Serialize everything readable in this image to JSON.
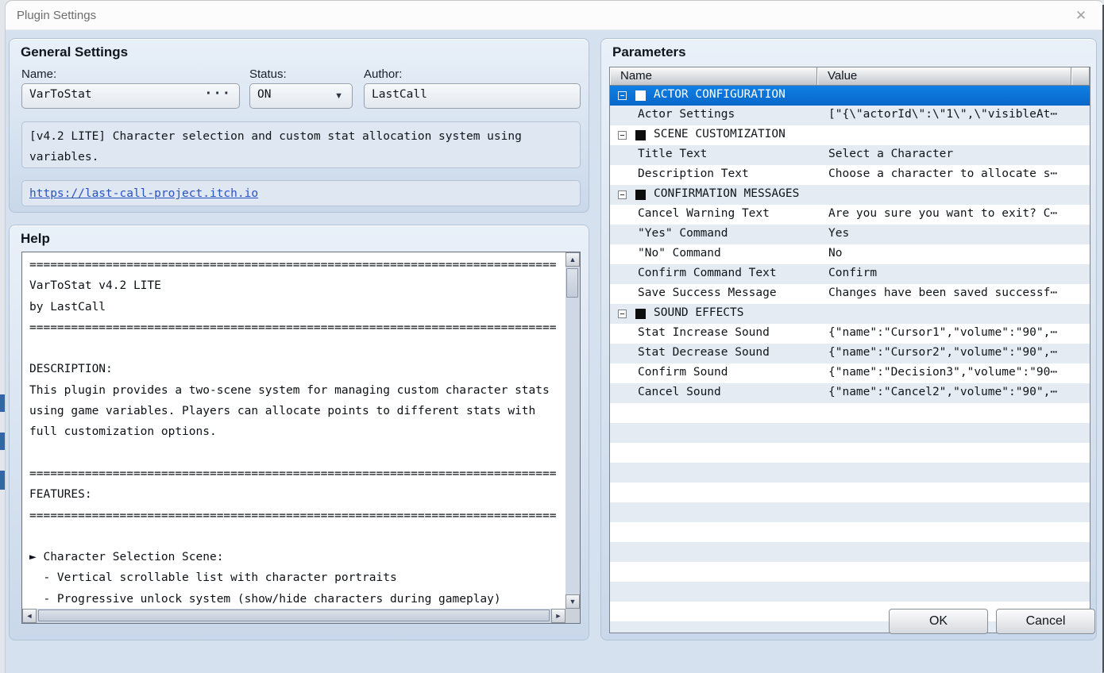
{
  "window": {
    "title": "Plugin Settings",
    "close_icon": "✕"
  },
  "colors": {
    "selection_top": "#1080e4",
    "selection_bottom": "#0767ca",
    "link": "#2a52be",
    "dialog_bg": "#d5e1ef",
    "row_alt": "#e4ebf3"
  },
  "general": {
    "section_title": "General Settings",
    "name_label": "Name:",
    "name_value": "VarToStat",
    "browse_dots": "···",
    "status_label": "Status:",
    "status_value": "ON",
    "dropdown_icon": "▼",
    "author_label": "Author:",
    "author_value": "LastCall",
    "description": "[v4.2 LITE] Character selection and custom stat allocation system using variables.",
    "link": "https://last-call-project.itch.io"
  },
  "help": {
    "section_title": "Help",
    "lines": [
      "============================================================================",
      "VarToStat v4.2 LITE",
      "by LastCall",
      "============================================================================",
      "",
      "DESCRIPTION:",
      "This plugin provides a two-scene system for managing custom character stats",
      "using game variables. Players can allocate points to different stats with",
      "full customization options.",
      "",
      "============================================================================",
      "FEATURES:",
      "============================================================================",
      "",
      "► Character Selection Scene:",
      "  - Vertical scrollable list with character portraits",
      "  - Progressive unlock system (show/hide characters during gameplay)"
    ],
    "scrollbar_icons": {
      "up": "▲",
      "down": "▼",
      "left": "◄",
      "right": "►"
    }
  },
  "parameters": {
    "section_title": "Parameters",
    "columns": [
      "Name",
      "Value"
    ],
    "rows": [
      {
        "type": "group",
        "name": "ACTOR CONFIGURATION",
        "selected": true
      },
      {
        "type": "param",
        "name": "Actor Settings",
        "value": "[\"{\\\"actorId\\\":\\\"1\\\",\\\"visibleAt⋯"
      },
      {
        "type": "group",
        "name": "SCENE CUSTOMIZATION"
      },
      {
        "type": "param",
        "name": "Title Text",
        "value": "Select a Character"
      },
      {
        "type": "param",
        "name": "Description Text",
        "value": "Choose a character to allocate s⋯"
      },
      {
        "type": "group",
        "name": "CONFIRMATION MESSAGES"
      },
      {
        "type": "param",
        "name": "Cancel Warning Text",
        "value": "Are you sure you want to exit? C⋯"
      },
      {
        "type": "param",
        "name": "\"Yes\" Command",
        "value": "Yes"
      },
      {
        "type": "param",
        "name": "\"No\" Command",
        "value": "No"
      },
      {
        "type": "param",
        "name": "Confirm Command Text",
        "value": "Confirm"
      },
      {
        "type": "param",
        "name": "Save Success Message",
        "value": "Changes have been saved successf⋯"
      },
      {
        "type": "group",
        "name": "SOUND EFFECTS"
      },
      {
        "type": "param",
        "name": "Stat Increase Sound",
        "value": "{\"name\":\"Cursor1\",\"volume\":\"90\",⋯"
      },
      {
        "type": "param",
        "name": "Stat Decrease Sound",
        "value": "{\"name\":\"Cursor2\",\"volume\":\"90\",⋯"
      },
      {
        "type": "param",
        "name": "Confirm Sound",
        "value": "{\"name\":\"Decision3\",\"volume\":\"90⋯"
      },
      {
        "type": "param",
        "name": "Cancel Sound",
        "value": "{\"name\":\"Cancel2\",\"volume\":\"90\",⋯"
      }
    ]
  },
  "footer": {
    "ok_label": "OK",
    "cancel_label": "Cancel"
  }
}
